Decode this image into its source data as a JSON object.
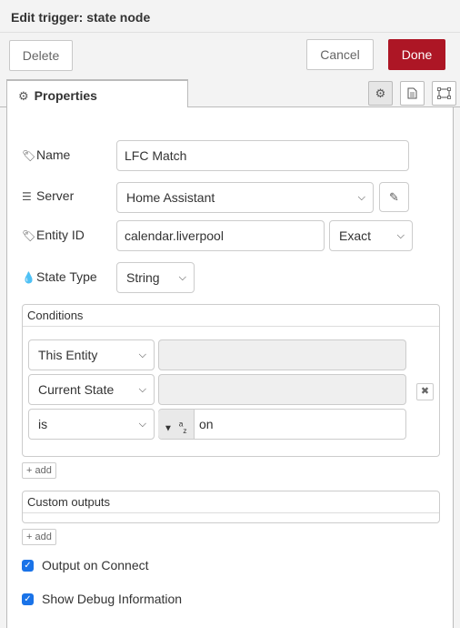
{
  "dialog": {
    "title": "Edit trigger: state node",
    "delete_label": "Delete",
    "cancel_label": "Cancel",
    "done_label": "Done"
  },
  "tabs": {
    "properties_label": "Properties"
  },
  "form": {
    "name_label": "Name",
    "name_value": "LFC Match",
    "server_label": "Server",
    "server_value": "Home Assistant",
    "entity_label": "Entity ID",
    "entity_value": "calendar.liverpool",
    "entity_match": "Exact",
    "state_type_label": "State Type",
    "state_type_value": "String"
  },
  "conditions": {
    "header": "Conditions",
    "row1_select": "This Entity",
    "row1_value": "",
    "row2_select": "Current State",
    "row2_value": "",
    "row3_select": "is",
    "row3_type": "a z",
    "row3_value": "on",
    "add_label": "add"
  },
  "custom_outputs": {
    "header": "Custom outputs",
    "add_label": "add"
  },
  "options": {
    "output_on_connect": "Output on Connect",
    "show_debug": "Show Debug Information"
  },
  "colors": {
    "accent": "#ad1625",
    "checkbox": "#1a73e8"
  }
}
